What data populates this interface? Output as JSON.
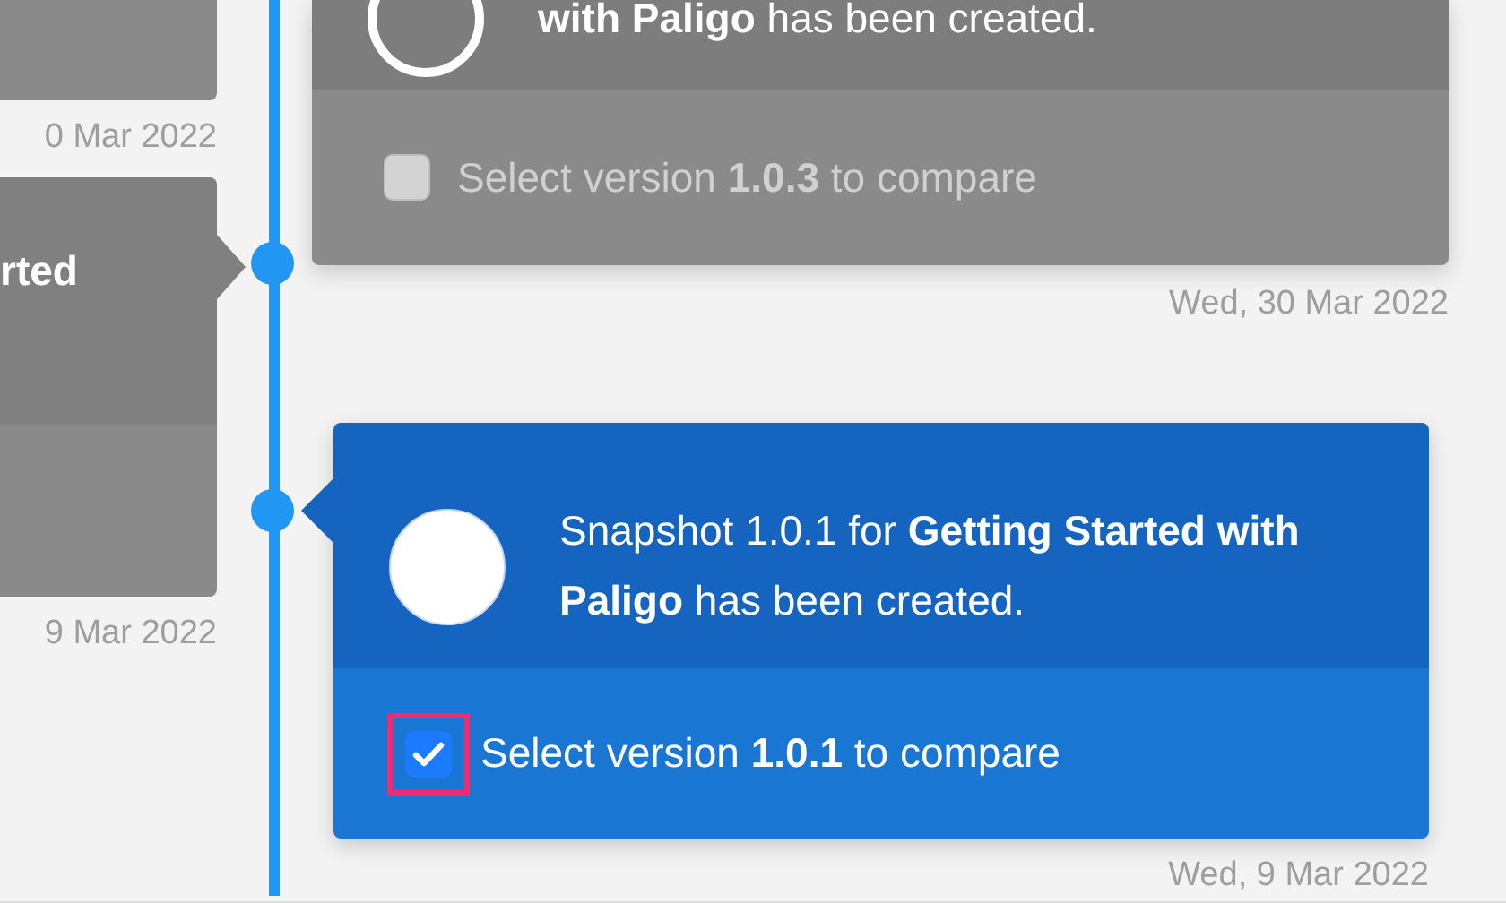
{
  "left_column": {
    "entries": [
      {
        "date": "0 Mar 2022"
      },
      {
        "message": "rted",
        "date": "9 Mar 2022"
      }
    ]
  },
  "right_column": {
    "entries": [
      {
        "message": "**with Paligo** has been created.",
        "compare_label": "Select version **1.0.3** to compare",
        "checked": false,
        "active": false,
        "highlighted": false,
        "date": "Wed, 30 Mar 2022"
      },
      {
        "message": "Snapshot 1.0.1 for **Getting Started with Paligo** has been created.",
        "compare_label": "Select version **1.0.1** to compare",
        "checked": true,
        "active": true,
        "highlighted": true,
        "date": "Wed, 9 Mar 2022"
      }
    ]
  }
}
